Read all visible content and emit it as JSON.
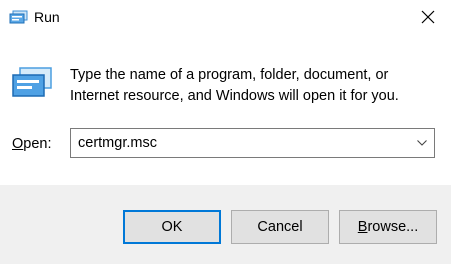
{
  "window": {
    "title": "Run",
    "icon": "run-icon",
    "close_icon": "close-icon"
  },
  "content": {
    "description_line1": "Type the name of a program, folder, document, or",
    "description_line2": "Internet resource, and Windows will open it for you.",
    "big_icon": "run-icon"
  },
  "open_field": {
    "label_mnemonic": "O",
    "label_rest": "pen:",
    "value": "certmgr.msc",
    "dropdown_icon": "chevron-down-icon"
  },
  "buttons": {
    "ok": "OK",
    "cancel": "Cancel",
    "browse_mnemonic": "B",
    "browse_rest": "rowse..."
  },
  "colors": {
    "accent": "#0078d7",
    "footer_bg": "#f0f0f0",
    "button_bg": "#e1e1e1"
  }
}
